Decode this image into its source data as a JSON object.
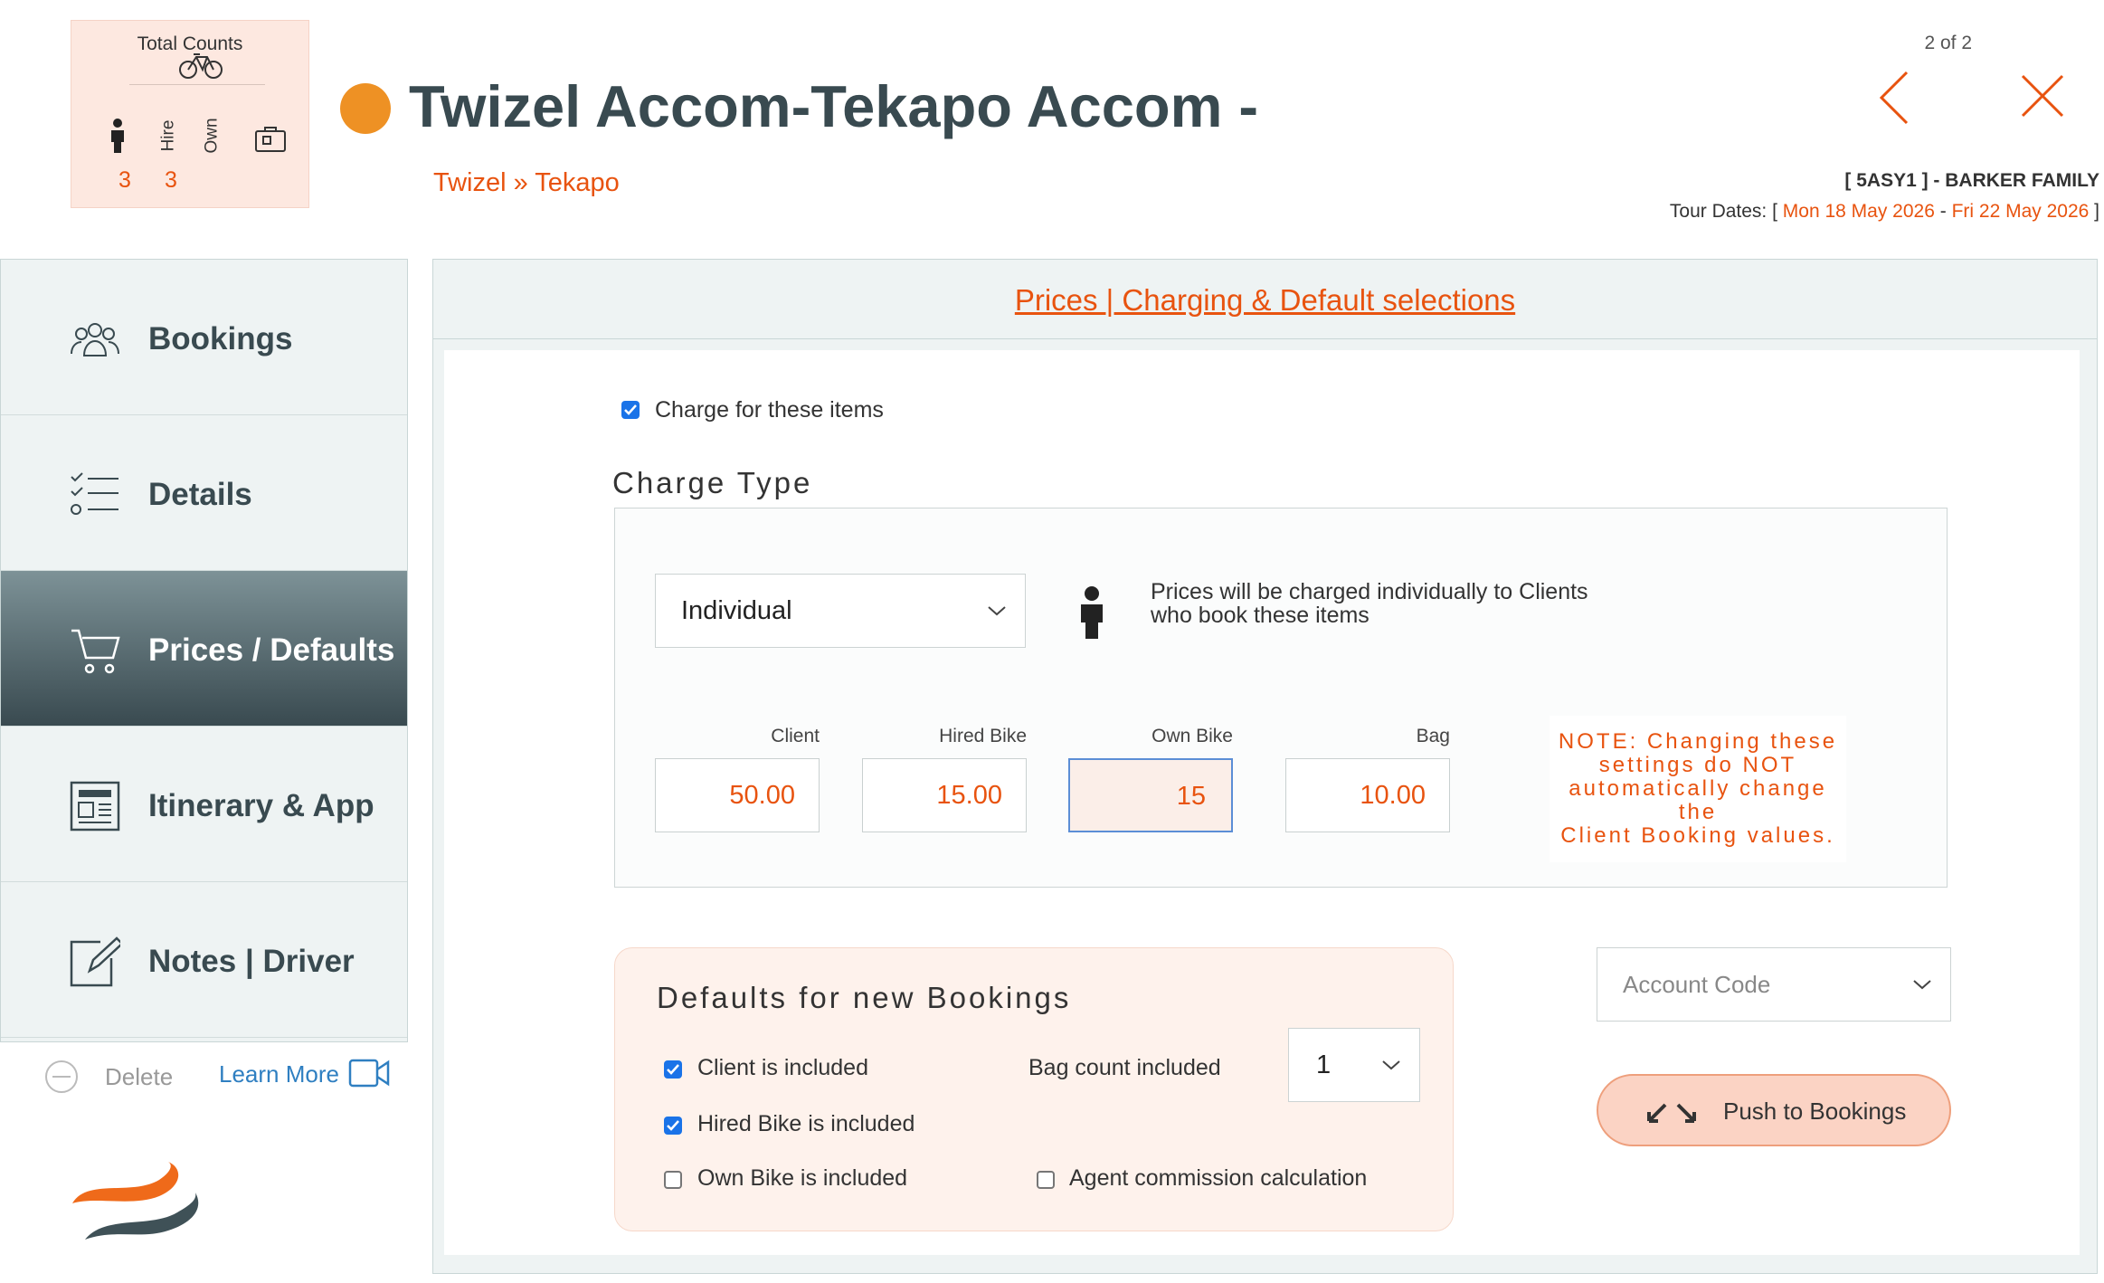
{
  "counts": {
    "title": "Total Counts",
    "hire_label": "Hire",
    "own_label": "Own",
    "person_count": "3",
    "hire_count": "3"
  },
  "header": {
    "title": "Twizel Accom-Tekapo Accom -",
    "status_color": "#ee9124",
    "breadcrumb": "Twizel » Tekapo",
    "pager": "2 of 2",
    "tour_id": "[ 5ASY1 ] - BARKER FAMILY",
    "tour_dates_label": "Tour Dates: [",
    "tour_start": "Mon 18 May 2026",
    "tour_dates_sep": " - ",
    "tour_end": "Fri 22 May 2026",
    "tour_dates_close": " ]"
  },
  "sidebar": {
    "items": [
      {
        "label": "Bookings",
        "icon": "users-icon"
      },
      {
        "label": "Details",
        "icon": "checklist-icon"
      },
      {
        "label": "Prices / Defaults",
        "icon": "cart-icon",
        "active": true
      },
      {
        "label": "Itinerary & App",
        "icon": "newspaper-icon"
      },
      {
        "label": "Notes | Driver",
        "icon": "edit-icon"
      }
    ],
    "delete_label": "Delete",
    "learn_more_label": "Learn More"
  },
  "main": {
    "header_link": "Prices | Charging & Default selections",
    "charge_checkbox_label": "Charge for these items",
    "charge_checked": true,
    "charge_type_heading": "Charge Type",
    "charge_type_value": "Individual",
    "charge_desc_line1": "Prices will be charged individually to Clients",
    "charge_desc_line2": "who book these items",
    "prices": [
      {
        "label": "Client",
        "value": "50.00"
      },
      {
        "label": "Hired Bike",
        "value": "15.00"
      },
      {
        "label": "Own Bike",
        "value": "15"
      },
      {
        "label": "Bag",
        "value": "10.00"
      }
    ],
    "note_line1": "NOTE: Changing these",
    "note_line2": "settings do NOT",
    "note_line3": "automatically change the",
    "note_line4": "Client Booking values.",
    "defaults_heading": "Defaults for new Bookings",
    "client_included": "Client is included",
    "hired_bike_included": "Hired Bike is included",
    "own_bike_included": "Own  Bike is included",
    "bag_count_label": "Bag count included",
    "bag_count_value": "1",
    "agent_commission": "Agent commission calculation",
    "account_code_placeholder": "Account Code",
    "push_button": "Push to Bookings"
  },
  "colors": {
    "accent": "#e8530f",
    "title": "#394a50",
    "panel": "#eef3f3",
    "active_nav": "#394a50"
  }
}
